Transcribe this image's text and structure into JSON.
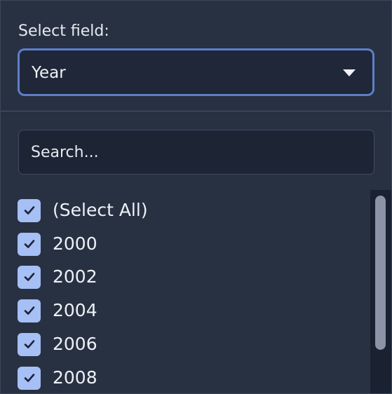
{
  "field_selector": {
    "label": "Select field:",
    "selected_value": "Year"
  },
  "search": {
    "placeholder": "Search..."
  },
  "filter_list": {
    "items": [
      {
        "label": "(Select All)",
        "checked": true
      },
      {
        "label": "2000",
        "checked": true
      },
      {
        "label": "2002",
        "checked": true
      },
      {
        "label": "2004",
        "checked": true
      },
      {
        "label": "2006",
        "checked": true
      },
      {
        "label": "2008",
        "checked": true
      }
    ]
  },
  "colors": {
    "accent": "#5d7fc9",
    "checkbox_fill": "#a6bff5",
    "panel_bg": "#283142"
  }
}
